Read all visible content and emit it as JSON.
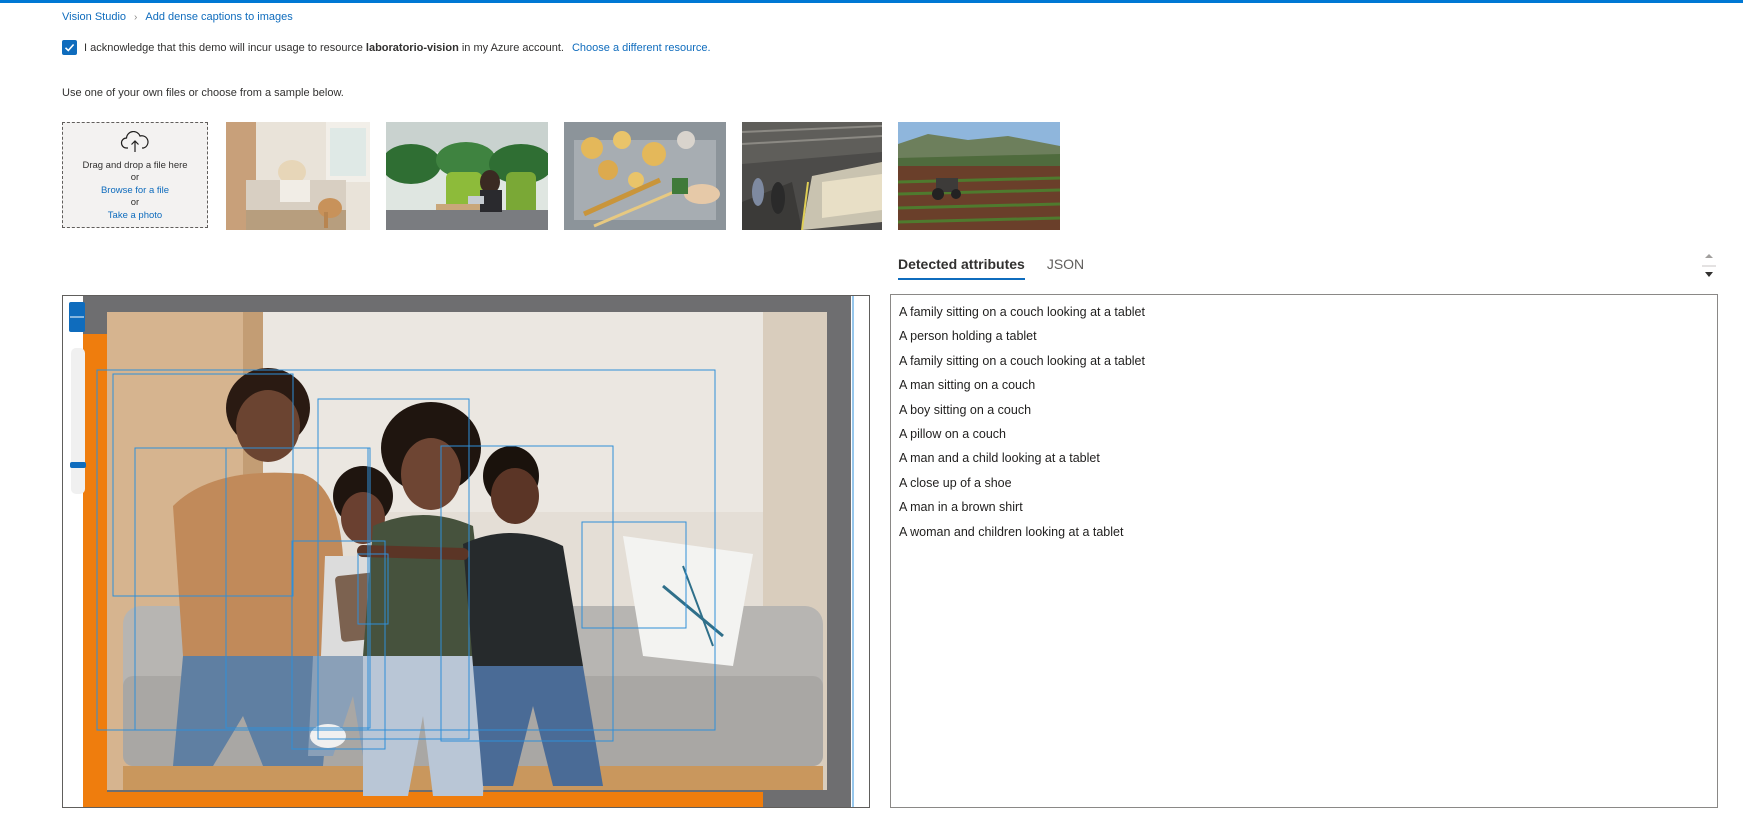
{
  "breadcrumb": {
    "root": "Vision Studio",
    "current": "Add dense captions to images"
  },
  "acknowledge": {
    "checked": true,
    "text_before": "I acknowledge that this demo will incur usage to resource",
    "resource": "laboratorio-vision",
    "text_after": "in my Azure account.",
    "change_link": "Choose a different resource."
  },
  "upload": {
    "hint": "Use one of your own files or choose from a sample below.",
    "drag_text": "Drag and drop a file here",
    "or1": "or",
    "browse": "Browse for a file",
    "or2": "or",
    "photo": "Take a photo"
  },
  "samples": [
    {
      "name": "sample-woman-reading-with-dog-icon"
    },
    {
      "name": "sample-woman-laptop-office-icon"
    },
    {
      "name": "sample-pasta-cooking-icon"
    },
    {
      "name": "sample-train-station-icon"
    },
    {
      "name": "sample-tractor-field-icon"
    }
  ],
  "tabs": {
    "detected": "Detected attributes",
    "json": "JSON"
  },
  "captions": [
    "A family sitting on a couch looking at a tablet",
    "A person holding a tablet",
    "A family sitting on a couch looking at a tablet",
    "A man sitting on a couch",
    "A boy sitting on a couch",
    "A pillow on a couch",
    "A man and a child looking at a tablet",
    "A close up of a shoe",
    "A man in a brown shirt",
    "A woman and children looking at a tablet"
  ],
  "colors": {
    "accent": "#0f6cbd",
    "highlight_orange": "#ef7d0d",
    "frame_gray": "#6e6e70",
    "box_blue": "#2f8fd8"
  }
}
